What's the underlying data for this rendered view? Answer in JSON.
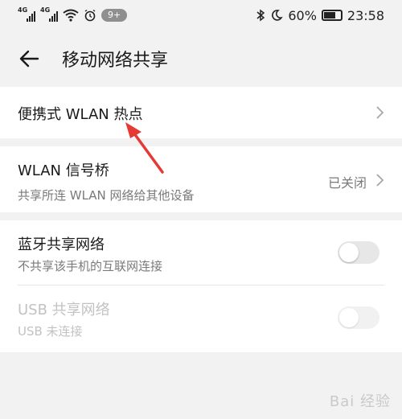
{
  "status_bar": {
    "signal1_tag": "4G",
    "signal2_tag": "4G",
    "notification_badge": "9+",
    "battery_percent": "60%",
    "time": "23:58"
  },
  "header": {
    "title": "移动网络共享",
    "back_icon": "back-arrow-icon"
  },
  "items": [
    {
      "label": "便携式 WLAN 热点"
    },
    {
      "label": "WLAN 信号桥",
      "subtitle": "共享所连 WLAN 网络给其他设备",
      "value": "已关闭"
    },
    {
      "label": "蓝牙共享网络",
      "subtitle": "不共享该手机的互联网连接",
      "toggle": "off"
    },
    {
      "label": "USB 共享网络",
      "subtitle": "USB 未连接",
      "toggle": "off",
      "disabled": true
    }
  ],
  "watermark": "Bai 经验",
  "colors": {
    "background": "#f2f2f2",
    "card": "#ffffff",
    "annotation_arrow": "#e53935"
  }
}
